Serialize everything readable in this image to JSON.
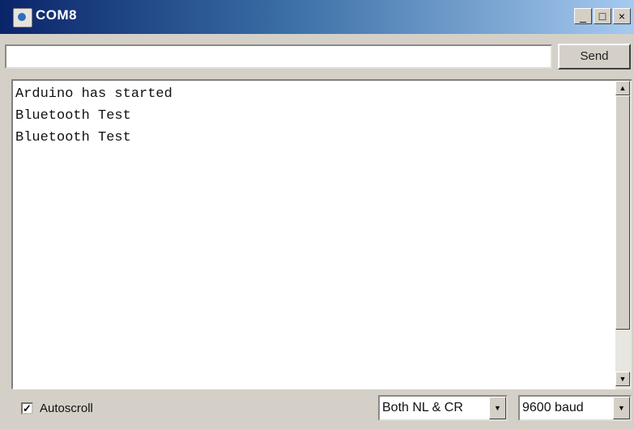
{
  "window": {
    "title": "COM8",
    "minimize_glyph": "_",
    "maximize_glyph": "□",
    "close_glyph": "×",
    "icon": "java-app-icon"
  },
  "send_bar": {
    "input_value": "",
    "send_label": "Send"
  },
  "output": {
    "lines": [
      "Arduino has started",
      "Bluetooth Test",
      "Bluetooth Test"
    ]
  },
  "scrollbar": {
    "up_glyph": "▲",
    "down_glyph": "▼"
  },
  "bottom_bar": {
    "autoscroll_label": "Autoscroll",
    "autoscroll_checked": true,
    "checkmark": "✓",
    "line_ending_selected": "Both NL & CR",
    "baud_selected": "9600 baud",
    "dropdown_glyph": "▼"
  }
}
